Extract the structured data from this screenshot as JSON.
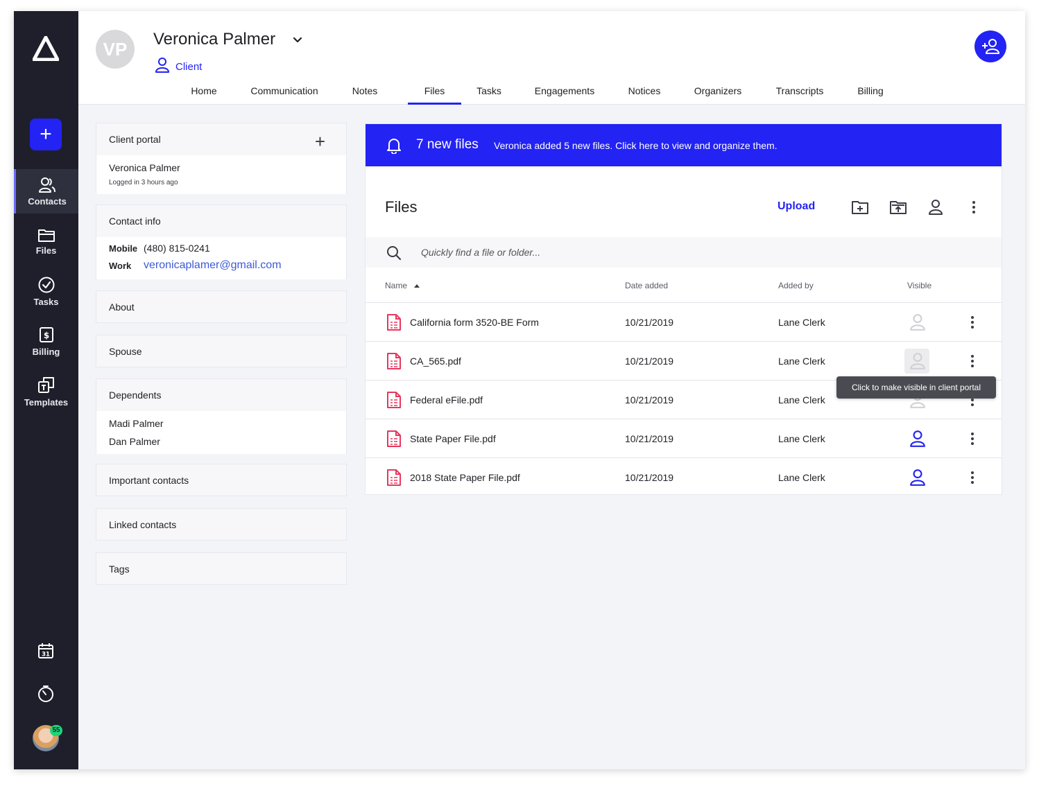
{
  "sidebar": {
    "add_label": "+",
    "items": [
      {
        "label": "Contacts",
        "icon": "contacts-icon"
      },
      {
        "label": "Files",
        "icon": "folder-icon"
      },
      {
        "label": "Tasks",
        "icon": "check-circle-icon"
      },
      {
        "label": "Billing",
        "icon": "billing-icon"
      },
      {
        "label": "Templates",
        "icon": "templates-icon"
      }
    ],
    "calendar_day": "31",
    "notification_count": "55"
  },
  "header": {
    "initials": "VP",
    "name": "Veronica Palmer",
    "role": "Client",
    "tabs": [
      "Home",
      "Communication",
      "Notes",
      "Files",
      "Tasks",
      "Engagements",
      "Notices",
      "Organizers",
      "Transcripts",
      "Billing"
    ],
    "active_tab": "Files"
  },
  "client_portal": {
    "title": "Client portal",
    "user": "Veronica Palmer",
    "status": "Logged in 3 hours ago"
  },
  "contact_info": {
    "title": "Contact info",
    "mobile_label": "Mobile",
    "mobile": "(480) 815-0241",
    "work_label": "Work",
    "email": "veronicaplamer@gmail.com"
  },
  "about": {
    "title": "About"
  },
  "spouse": {
    "title": "Spouse"
  },
  "dependents": {
    "title": "Dependents",
    "items": [
      "Madi Palmer",
      "Dan Palmer"
    ]
  },
  "important_contacts": {
    "title": "Important contacts"
  },
  "linked_contacts": {
    "title": "Linked contacts"
  },
  "tags": {
    "title": "Tags"
  },
  "banner": {
    "title": "7 new files",
    "text": "Veronica added 5 new files. Click here to view and organize them."
  },
  "files": {
    "title": "Files",
    "upload_label": "Upload",
    "search_placeholder": "Quickly find a file or folder...",
    "columns": {
      "name": "Name",
      "date": "Date added",
      "added_by": "Added by",
      "visible": "Visible"
    },
    "rows": [
      {
        "name": "California form 3520-BE Form",
        "date": "10/21/2019",
        "added_by": "Lane Clerk",
        "visible": false
      },
      {
        "name": "CA_565.pdf",
        "date": "10/21/2019",
        "added_by": "Lane Clerk",
        "visible": false
      },
      {
        "name": "Federal eFile.pdf",
        "date": "10/21/2019",
        "added_by": "Lane Clerk",
        "visible": false
      },
      {
        "name": "State Paper File.pdf",
        "date": "10/21/2019",
        "added_by": "Lane Clerk",
        "visible": true
      },
      {
        "name": "2018 State Paper File.pdf",
        "date": "10/21/2019",
        "added_by": "Lane Clerk",
        "visible": true
      }
    ],
    "tooltip": "Click to make visible in client portal"
  },
  "colors": {
    "accent": "#2323f3",
    "sidebar": "#1e1f2b",
    "file_icon": "#e8365d",
    "badge": "#1fd47a"
  }
}
